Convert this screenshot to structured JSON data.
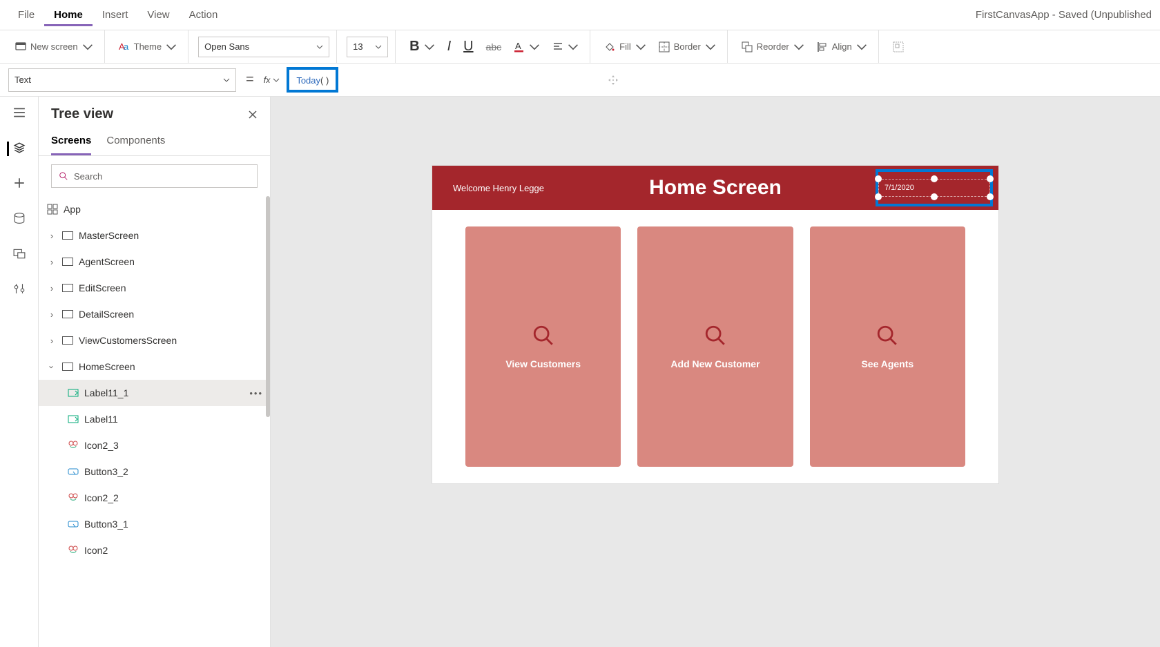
{
  "window_title": "FirstCanvasApp - Saved (Unpublished",
  "menubar": {
    "items": [
      "File",
      "Home",
      "Insert",
      "View",
      "Action"
    ],
    "active": 1
  },
  "ribbon": {
    "new_screen": "New screen",
    "theme": "Theme",
    "font": "Open Sans",
    "font_size": "13",
    "fill": "Fill",
    "border": "Border",
    "reorder": "Reorder",
    "align": "Align"
  },
  "formula": {
    "property": "Text",
    "fn": "Today",
    "parens": "( )"
  },
  "tree": {
    "title": "Tree view",
    "tabs": {
      "screens": "Screens",
      "components": "Components",
      "active": 0
    },
    "search_placeholder": "Search",
    "app": "App",
    "screens": [
      {
        "name": "MasterScreen"
      },
      {
        "name": "AgentScreen"
      },
      {
        "name": "EditScreen"
      },
      {
        "name": "DetailScreen"
      },
      {
        "name": "ViewCustomersScreen"
      },
      {
        "name": "HomeScreen",
        "expanded": true
      }
    ],
    "children": [
      {
        "name": "Label11_1",
        "icon": "label",
        "selected": true
      },
      {
        "name": "Label11",
        "icon": "label"
      },
      {
        "name": "Icon2_3",
        "icon": "icon"
      },
      {
        "name": "Button3_2",
        "icon": "button"
      },
      {
        "name": "Icon2_2",
        "icon": "icon"
      },
      {
        "name": "Button3_1",
        "icon": "button"
      },
      {
        "name": "Icon2",
        "icon": "icon"
      }
    ]
  },
  "canvas": {
    "welcome": "Welcome Henry Legge",
    "title": "Home Screen",
    "date": "7/1/2020",
    "tiles": [
      "View Customers",
      "Add New Customer",
      "See Agents"
    ]
  }
}
